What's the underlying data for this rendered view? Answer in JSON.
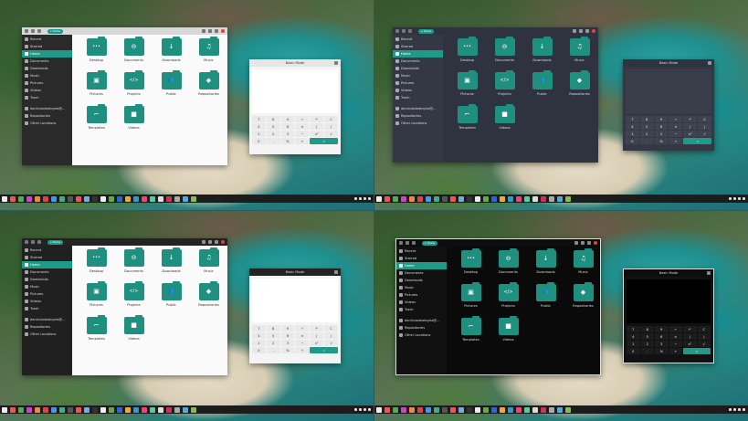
{
  "panels": [
    {
      "id": "q1",
      "theme": "light-greytitle",
      "window_title": "Home",
      "calculator_mode": "Basic Mode"
    },
    {
      "id": "q2",
      "theme": "dark",
      "window_title": "Home",
      "calculator_mode": "Basic Mode"
    },
    {
      "id": "q3",
      "theme": "light-blacktitle",
      "window_title": "Home",
      "calculator_mode": "Basic Mode"
    },
    {
      "id": "q4",
      "theme": "black",
      "window_title": "Home",
      "calculator_mode": "Basic Mode"
    }
  ],
  "sidebar": {
    "items": [
      {
        "label": "Recent",
        "icon": "clock-icon"
      },
      {
        "label": "Starred",
        "icon": "star-icon"
      },
      {
        "label": "Home",
        "icon": "home-icon",
        "active": true
      },
      {
        "label": "Documents",
        "icon": "document-icon"
      },
      {
        "label": "Downloads",
        "icon": "download-icon"
      },
      {
        "label": "Music",
        "icon": "music-icon"
      },
      {
        "label": "Pictures",
        "icon": "picture-icon"
      },
      {
        "label": "Videos",
        "icon": "video-icon"
      },
      {
        "label": "Trash",
        "icon": "trash-icon"
      }
    ],
    "devices": [
      {
        "label": "daniruizdeaIngria@...",
        "icon": "drive-icon"
      },
      {
        "label": "Repositories",
        "icon": "folder-icon"
      },
      {
        "label": "Other Locations",
        "icon": "plus-icon"
      }
    ]
  },
  "folders": [
    {
      "label": "Desktop",
      "glyph": "•••"
    },
    {
      "label": "Documents",
      "glyph": "⊖"
    },
    {
      "label": "Downloads",
      "glyph": "↓"
    },
    {
      "label": "Music",
      "glyph": "♫"
    },
    {
      "label": "Pictures",
      "glyph": "▣"
    },
    {
      "label": "Projects",
      "glyph": "</>"
    },
    {
      "label": "Public",
      "glyph": "👥"
    },
    {
      "label": "Repositories",
      "glyph": "◆"
    },
    {
      "label": "Templates",
      "glyph": "⌐"
    },
    {
      "label": "Videos",
      "glyph": "■"
    }
  ],
  "calculator_keys": [
    "7",
    "8",
    "9",
    "÷",
    "↶",
    "C",
    "4",
    "5",
    "6",
    "×",
    "(",
    ")",
    "1",
    "2",
    "3",
    "−",
    "x²",
    "√",
    "0",
    ".",
    "%",
    "+",
    "="
  ],
  "colors": {
    "accent": "#1f9a88",
    "folder": "#1f8f80",
    "close": "#e0443a"
  }
}
